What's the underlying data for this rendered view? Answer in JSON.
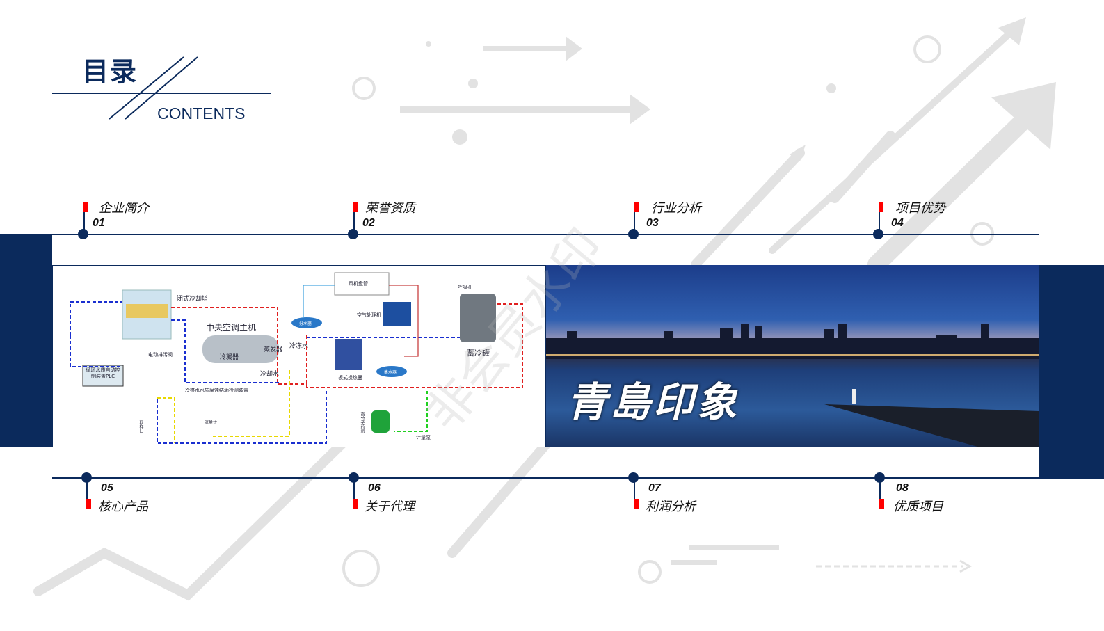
{
  "header": {
    "title": "目录",
    "subtitle": "CONTENTS"
  },
  "colors": {
    "primary": "#0b2a5c",
    "accent": "#ff0000",
    "decoration": "#e2e2e2"
  },
  "top_items": [
    {
      "number": "01",
      "label": "企业简介"
    },
    {
      "number": "02",
      "label": "荣誉资质"
    },
    {
      "number": "03",
      "label": "行业分析"
    },
    {
      "number": "04",
      "label": "项目优势"
    }
  ],
  "bottom_items": [
    {
      "number": "05",
      "label": "核心产品"
    },
    {
      "number": "06",
      "label": "关于代理"
    },
    {
      "number": "07",
      "label": "利润分析"
    },
    {
      "number": "08",
      "label": "优质项目"
    }
  ],
  "diagram": {
    "labels": [
      "闭式冷却塔",
      "中央空调主机",
      "冷凝器",
      "蒸发器",
      "冷冻水",
      "冷却水",
      "分水器",
      "集水器",
      "风机盘管",
      "空气处理机",
      "蓄冷罐",
      "呼吸孔",
      "板式换热器",
      "电动排污阀",
      "循环水质自动控制装置PLC",
      "冷媒水水质腐蚀结垢检测装置",
      "计量泵",
      "高分子药剂",
      "流量计",
      "取样口"
    ]
  },
  "photo": {
    "calligraphy": "青島印象"
  },
  "watermark": "非会员水印"
}
